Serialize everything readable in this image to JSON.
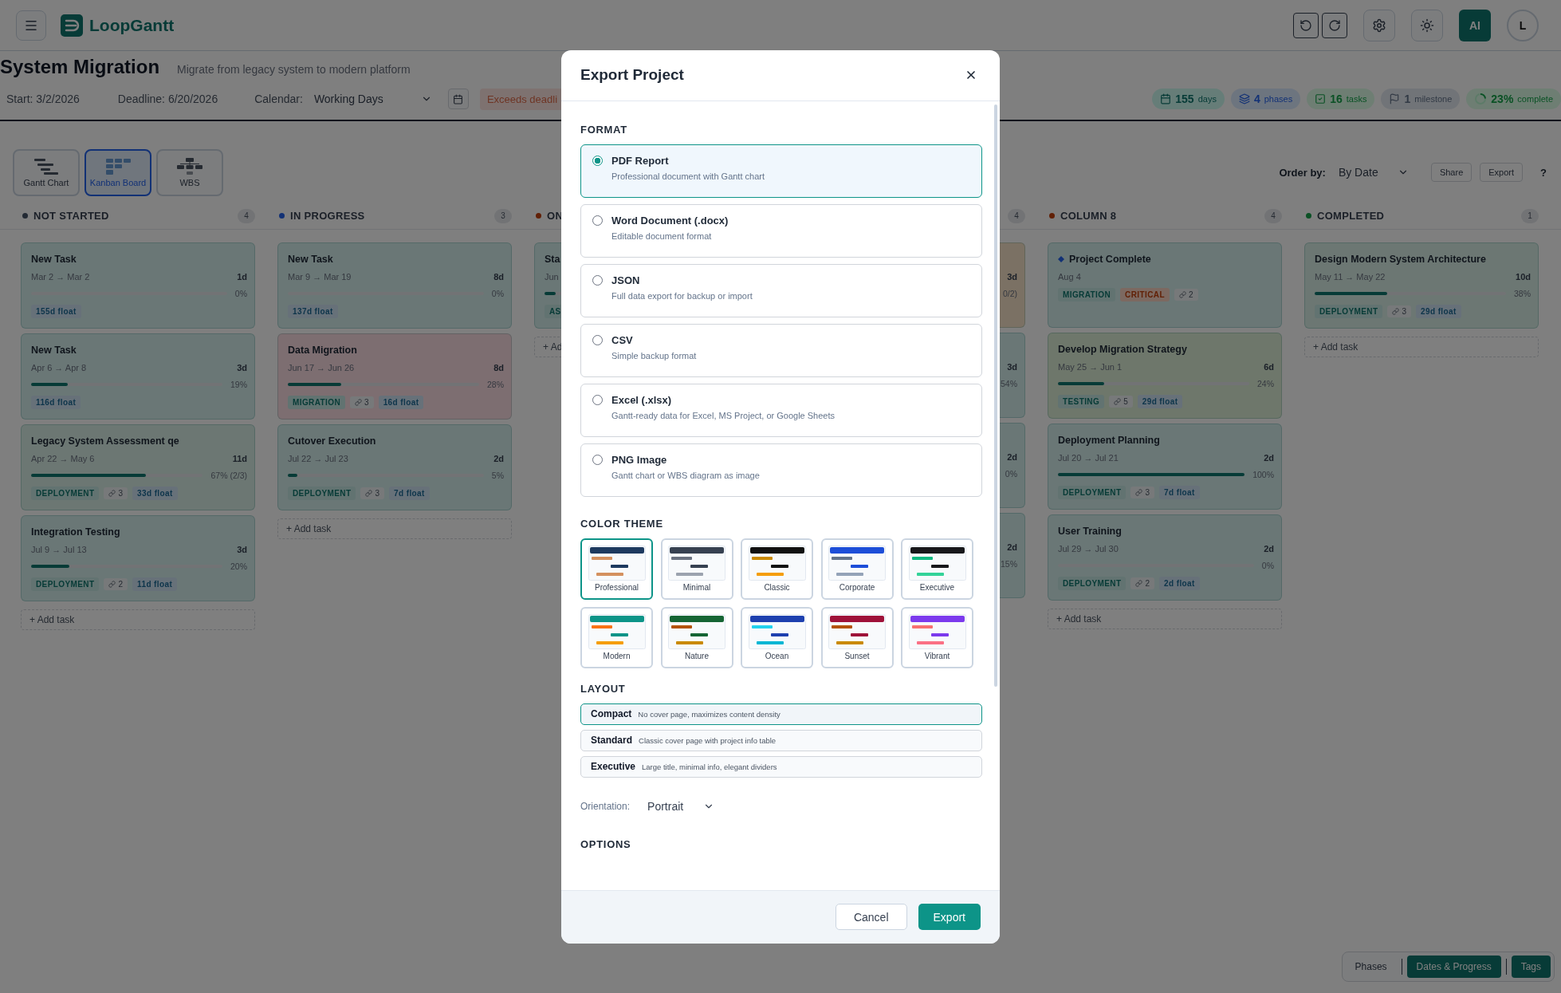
{
  "app": {
    "brand": "LoopGantt",
    "ai_label": "AI",
    "avatar": "L"
  },
  "project": {
    "title": "System Migration",
    "subtitle": "Migrate from legacy system to modern platform",
    "start": "Start: 3/2/2026",
    "deadline": "Deadline: 6/20/2026",
    "calendar_label": "Calendar:",
    "calendar_value": "Working Days",
    "warning": "Exceeds deadli"
  },
  "stats": [
    {
      "kind": "days",
      "value": "155",
      "label": "days"
    },
    {
      "kind": "phases",
      "value": "4",
      "label": "phases"
    },
    {
      "kind": "tasks",
      "value": "16",
      "label": "tasks"
    },
    {
      "kind": "milestone",
      "value": "1",
      "label": "milestone"
    },
    {
      "kind": "complete",
      "value": "23%",
      "label": "complete",
      "level": 0.23
    }
  ],
  "views": [
    {
      "kind": "gantt",
      "label": "Gantt Chart",
      "selected": false
    },
    {
      "kind": "kanban",
      "label": "Kanban Board",
      "selected": true
    },
    {
      "kind": "wbs",
      "label": "WBS",
      "selected": false
    }
  ],
  "toolbar": {
    "order_label": "Order by:",
    "order_value": "By Date",
    "share": "Share",
    "export": "Export",
    "help": "?"
  },
  "columns": [
    {
      "name": "NOT STARTED",
      "color": "#232a34",
      "count": "4",
      "add_label": "+ Add task",
      "cards": [
        {
          "kind": "task",
          "title": "New Task",
          "color": "#6a7776",
          "dates": "Mar 2 → Mar 2",
          "duration": "1d",
          "percent": "0%",
          "float": "155d float"
        },
        {
          "kind": "task",
          "title": "New Task",
          "color": "#6a7776",
          "dates": "Apr 6 → Apr 8",
          "duration": "3d",
          "level": 0.19,
          "percent": "19%",
          "float": "116d float"
        },
        {
          "kind": "task",
          "title": "Legacy System Assessment qe",
          "color": "#6c7773",
          "dates": "Apr 22 → May 6",
          "duration": "11d",
          "level": 0.67,
          "percent": "67% (2/3)",
          "tags": [
            {
              "label": "DEPLOYMENT",
              "kind": "phase"
            }
          ],
          "links": "3",
          "float": "33d float"
        },
        {
          "kind": "task",
          "title": "Integration Testing",
          "color": "#6a7776",
          "dates": "Jul 9 → Jul 13",
          "duration": "3d",
          "level": 0.2,
          "percent": "20%",
          "tags": [
            {
              "label": "DEPLOYMENT",
              "kind": "phase"
            }
          ],
          "links": "2",
          "float": "11d float"
        }
      ]
    },
    {
      "name": "IN PROGRESS",
      "color": "#123175",
      "count": "3",
      "add_label": "+ Add task",
      "cards": [
        {
          "kind": "task",
          "title": "New Task",
          "color": "#6a7776",
          "dates": "Mar 9 → Mar 19",
          "duration": "8d",
          "percent": "0%",
          "float": "137d float"
        },
        {
          "kind": "task",
          "title": "Data Migration",
          "color": "#7d6e71",
          "dates": "Jun 17 → Jun 26",
          "duration": "8d",
          "level": 0.28,
          "percent": "28%",
          "tags": [
            {
              "label": "MIGRATION",
              "kind": "phase"
            }
          ],
          "links": "3",
          "float": "16d float"
        },
        {
          "kind": "task",
          "title": "Cutover Execution",
          "color": "#6a7776",
          "dates": "Jul 22 → Jul 23",
          "duration": "2d",
          "level": 0.05,
          "percent": "5%",
          "tags": [
            {
              "label": "DEPLOYMENT",
              "kind": "phase"
            }
          ],
          "links": "3",
          "float": "7d float"
        }
      ]
    },
    {
      "name": "ON",
      "color": "#612006",
      "add_label": "+ Ad",
      "cards": [
        {
          "kind": "task",
          "title": "Sta",
          "color": "#6a7776",
          "dates": "Jun",
          "level": 0.05,
          "tags": [
            {
              "label": "AS",
              "kind": "phase"
            }
          ]
        }
      ]
    },
    {
      "count": "4",
      "cards": [
        {
          "kind": "task",
          "color": "#7b7164",
          "duration": "3d",
          "percent": "0/2)"
        },
        {
          "kind": "task",
          "color": "#6a7776",
          "duration": "3d",
          "percent": "54%"
        },
        {
          "kind": "task",
          "color": "#6a7776",
          "duration": "2d",
          "percent": "0%"
        },
        {
          "kind": "task",
          "color": "#6a7776",
          "duration": "2d",
          "percent": "15%"
        }
      ]
    },
    {
      "name": "COLUMN 8",
      "color": "#612006",
      "count": "4",
      "add_label": "+ Add task",
      "cards": [
        {
          "kind": "milestone",
          "title": "Project Complete",
          "color": "#6a7776",
          "dates": "Aug 4",
          "tags": [
            {
              "label": "MIGRATION",
              "kind": "phase"
            },
            {
              "label": "CRITICAL",
              "kind": "critical"
            }
          ],
          "links": "2"
        },
        {
          "kind": "task",
          "title": "Develop Migration Strategy",
          "color": "#6e776b",
          "dates": "May 25 → Jun 1",
          "duration": "6d",
          "level": 0.24,
          "percent": "24%",
          "tags": [
            {
              "label": "TESTING",
              "kind": "phase"
            }
          ],
          "links": "5",
          "float": "29d float"
        },
        {
          "kind": "task",
          "title": "Deployment Planning",
          "color": "#6a7776",
          "dates": "Jul 20 → Jul 21",
          "duration": "2d",
          "level": 1,
          "percent": "100%",
          "tags": [
            {
              "label": "DEPLOYMENT",
              "kind": "phase"
            }
          ],
          "links": "3",
          "float": "7d float"
        },
        {
          "kind": "task",
          "title": "User Training",
          "color": "#6a7776",
          "dates": "Jul 29 → Jul 30",
          "duration": "2d",
          "percent": "0%",
          "tags": [
            {
              "label": "DEPLOYMENT",
              "kind": "phase"
            }
          ],
          "links": "2",
          "float": "2d float"
        }
      ]
    },
    {
      "name": "COMPLETED",
      "color": "#0b5125",
      "count": "1",
      "add_label": "+ Add task",
      "cards": [
        {
          "kind": "task",
          "title": "Design Modern System Architecture",
          "color": "#6c7773",
          "dates": "May 11 → May 22",
          "duration": "10d",
          "level": 0.38,
          "percent": "38%",
          "tags": [
            {
              "label": "DEPLOYMENT",
              "kind": "phase"
            }
          ],
          "links": "3",
          "float": "29d float"
        }
      ]
    }
  ],
  "display_toggles": [
    {
      "label": "Phases",
      "on": false
    },
    {
      "label": "Dates & Progress",
      "on": true
    },
    {
      "label": "Tags",
      "on": true
    }
  ],
  "dialog": {
    "title": "Export Project",
    "format_heading": "FORMAT",
    "formats": [
      {
        "name": "PDF Report",
        "description": "Professional document with Gantt chart",
        "selected": true
      },
      {
        "name": "Word Document (.docx)",
        "description": "Editable document format",
        "selected": false
      },
      {
        "name": "JSON",
        "description": "Full data export for backup or import",
        "selected": false
      },
      {
        "name": "CSV",
        "description": "Simple backup format",
        "selected": false
      },
      {
        "name": "Excel (.xlsx)",
        "description": "Gantt-ready data for Excel, MS Project, or Google Sheets",
        "selected": false
      },
      {
        "name": "PNG Image",
        "description": "Gantt chart or WBS diagram as image",
        "selected": false
      }
    ],
    "theme_heading": "COLOR THEME",
    "themes": [
      {
        "name": "Professional",
        "color": "#1e3a5f",
        "bars": [
          {
            "color": "#d4915f"
          },
          {
            "color": "#1e3a5f"
          },
          {
            "color": "#d4915f"
          }
        ],
        "selected": true
      },
      {
        "name": "Minimal",
        "color": "#374151",
        "bars": [
          {
            "color": "#6b7280"
          },
          {
            "color": "#374151"
          },
          {
            "color": "#9ca3af"
          }
        ],
        "selected": false
      },
      {
        "name": "Classic",
        "color": "#111111",
        "bars": [
          {
            "color": "#ca8a04"
          },
          {
            "color": "#111111"
          },
          {
            "color": "#f59e0b"
          }
        ],
        "selected": false
      },
      {
        "name": "Corporate",
        "color": "#1d4ed8",
        "bars": [
          {
            "color": "#64748b"
          },
          {
            "color": "#1d4ed8"
          },
          {
            "color": "#94a3b8"
          }
        ],
        "selected": false
      },
      {
        "name": "Executive",
        "color": "#18181b",
        "bars": [
          {
            "color": "#10b981"
          },
          {
            "color": "#18181b"
          },
          {
            "color": "#34d399"
          }
        ],
        "selected": false
      },
      {
        "name": "Modern",
        "color": "#0d9488",
        "bars": [
          {
            "color": "#f97316"
          },
          {
            "color": "#0d9488"
          },
          {
            "color": "#f59e0b"
          }
        ],
        "selected": false
      },
      {
        "name": "Nature",
        "color": "#166534",
        "bars": [
          {
            "color": "#b45309"
          },
          {
            "color": "#166534"
          },
          {
            "color": "#ca8a04"
          }
        ],
        "selected": false
      },
      {
        "name": "Ocean",
        "color": "#1e40af",
        "bars": [
          {
            "color": "#22d3ee"
          },
          {
            "color": "#1e40af"
          },
          {
            "color": "#06b6d4"
          }
        ],
        "selected": false
      },
      {
        "name": "Sunset",
        "color": "#9f1239",
        "bars": [
          {
            "color": "#b45309"
          },
          {
            "color": "#9f1239"
          },
          {
            "color": "#ca8a04"
          }
        ],
        "selected": false
      },
      {
        "name": "Vibrant",
        "color": "#7c3aed",
        "bars": [
          {
            "color": "#f87171"
          },
          {
            "color": "#7c3aed"
          },
          {
            "color": "#fb7185"
          }
        ],
        "selected": false
      }
    ],
    "layout_heading": "LAYOUT",
    "layouts": [
      {
        "name": "Compact",
        "description": "No cover page, maximizes content density",
        "selected": true
      },
      {
        "name": "Standard",
        "description": "Classic cover page with project info table",
        "selected": false
      },
      {
        "name": "Executive",
        "description": "Large title, minimal info, elegant dividers",
        "selected": false
      }
    ],
    "orientation_label": "Orientation:",
    "orientation_value": "Portrait",
    "options_heading": "OPTIONS",
    "cancel": "Cancel",
    "export": "Export"
  }
}
